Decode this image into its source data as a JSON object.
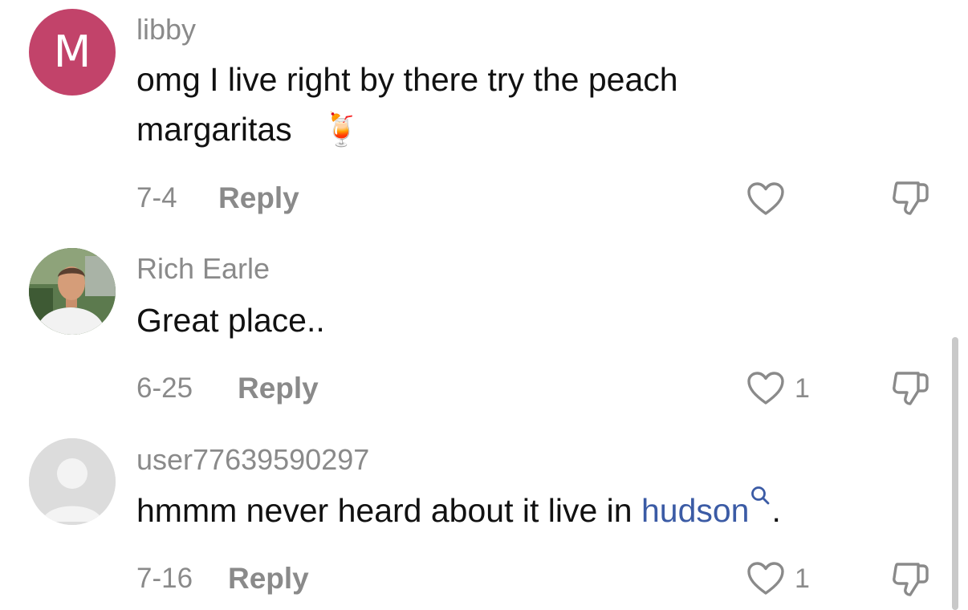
{
  "comments": [
    {
      "avatar_letter": "M",
      "username": "libby",
      "text_line1": "omg I live right by there try the peach",
      "text_line2": "margaritas",
      "emoji": "🍹",
      "date": "7-4",
      "reply_label": "Reply",
      "like_count": ""
    },
    {
      "username": "Rich Earle",
      "text_line1": "Great place..",
      "date": "6-25",
      "reply_label": "Reply",
      "like_count": "1"
    },
    {
      "username": "user77639590297",
      "text_before_link": "hmmm never heard about it live in ",
      "link_text": "hudson",
      "text_after_link": ".",
      "date": "7-16",
      "reply_label": "Reply",
      "like_count": "1"
    }
  ],
  "colors": {
    "avatar_m_bg": "#c2436a",
    "link": "#3b5ba5",
    "meta_gray": "#8a8a8a"
  },
  "icons": {
    "like": "heart-outline-icon",
    "dislike": "thumbs-down-outline-icon",
    "search": "search-icon"
  }
}
